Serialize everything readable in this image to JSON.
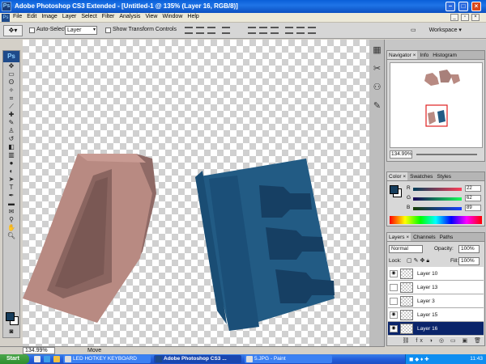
{
  "window": {
    "app_icon": "Ps",
    "title": "Adobe Photoshop CS3 Extended - [Untitled-1 @ 135% (Layer 16, RGB/8)]"
  },
  "menu": [
    "File",
    "Edit",
    "Image",
    "Layer",
    "Select",
    "Filter",
    "Analysis",
    "View",
    "Window",
    "Help"
  ],
  "options": {
    "auto_select_label": "Auto-Select:",
    "auto_select_value": "Layer",
    "show_transform_label": "Show Transform Controls",
    "workspace_label": "Workspace ▾"
  },
  "toolbox": {
    "logo": "Ps"
  },
  "status": {
    "zoom": "134.99%",
    "tool": "Move"
  },
  "navigator": {
    "tabs": [
      "Navigator ×",
      "Info",
      "Histogram"
    ],
    "zoom": "134.99%"
  },
  "color": {
    "tabs": [
      "Color ×",
      "Swatches",
      "Styles"
    ],
    "channels": [
      {
        "label": "R",
        "value": "22"
      },
      {
        "label": "G",
        "value": "62"
      },
      {
        "label": "B",
        "value": "89"
      }
    ],
    "foreground": "#163d5c"
  },
  "layers": {
    "tabs": [
      "Layers ×",
      "Channels",
      "Paths"
    ],
    "blend_mode": "Normal",
    "opacity_label": "Opacity:",
    "opacity": "100%",
    "lock_label": "Lock:",
    "fill_label": "Fill:",
    "fill": "100%",
    "items": [
      {
        "name": "Layer 10",
        "visible": true
      },
      {
        "name": "Layer 13",
        "visible": false
      },
      {
        "name": "Layer 3",
        "visible": false
      },
      {
        "name": "Layer 15",
        "visible": true
      },
      {
        "name": "Layer 16",
        "visible": true
      }
    ]
  },
  "taskbar": {
    "start": "Start",
    "tasks": [
      {
        "label": "LED HOTKEY KEYBOARD"
      },
      {
        "label": "Adobe Photoshop CS3 ..."
      },
      {
        "label": "5.JPG - Paint"
      }
    ],
    "clock": "11:43"
  }
}
